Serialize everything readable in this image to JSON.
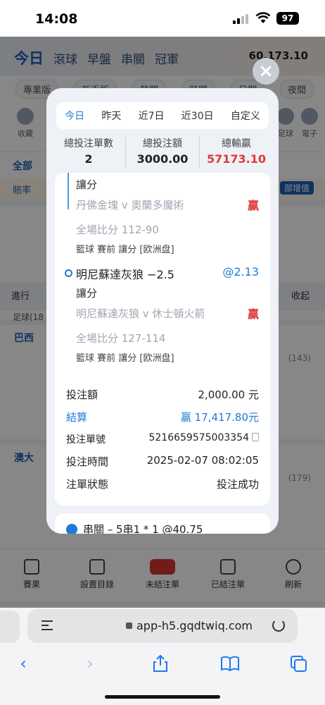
{
  "status_bar": {
    "time": "14:08",
    "battery": "97"
  },
  "background": {
    "nav": {
      "today": "今日",
      "live": "滾球",
      "early": "早盤",
      "parlay": "串關",
      "champion": "冠軍"
    },
    "balance": "60,173.10",
    "filters": {
      "mode": "專業版",
      "newbie": "新手版",
      "hot": "熱門",
      "time": "時間",
      "date": "日期",
      "night": "夜間"
    },
    "cats": {
      "fav": "收藏",
      "football": "足球",
      "esports": "電子"
    },
    "all_tab": "全部",
    "notice": {
      "text": "賠率",
      "tag": "部增值"
    },
    "section": {
      "title": "進行",
      "collapse": "收起",
      "sub": "足球(18"
    },
    "rows": [
      {
        "head": "巴西",
        "count": "(143)"
      },
      {
        "head": "澳大",
        "count": "(179)"
      }
    ],
    "bottom_nav": {
      "results": "賽果",
      "settings": "設置目錄",
      "unsettled": "未結注單",
      "settled": "已結注單",
      "refresh": "刷新"
    }
  },
  "modal": {
    "period_tabs": [
      "今日",
      "昨天",
      "近7日",
      "近30日",
      "自定义"
    ],
    "active_tab": "今日",
    "stats": {
      "count_label": "總投注單數",
      "count": "2",
      "amount_label": "總投注額",
      "amount": "3000.00",
      "winloss_label": "總輸贏",
      "winloss": "57173.10"
    },
    "legs": [
      {
        "bet_type": "讓分",
        "match": "丹佛金塊 v 奧蘭多魔術",
        "result": "贏",
        "score": "全場比分 112-90",
        "meta": "籃球 賽前  讓分 [欧洲盘]"
      },
      {
        "selection": "明尼蘇達灰狼 −2.5",
        "odds": "@2.13",
        "bet_type": "讓分",
        "match": "明尼蘇達灰狼 v 休士頓火箭",
        "result": "贏",
        "score": "全場比分 127-114",
        "meta": "籃球 賽前  讓分 [欧洲盘]"
      }
    ],
    "details": {
      "stake_label": "投注額",
      "stake": "2,000.00 元",
      "settle_label": "結算",
      "settle": "贏 17,417.80元",
      "id_label": "投注單號",
      "id": "5216659575003354",
      "time_label": "投注時間",
      "time": "2025-02-07 08:02:05",
      "status_label": "注單狀態",
      "status": "投注成功"
    },
    "next_card": "串關 – 5串1 * 1 @40.75"
  },
  "browser": {
    "url": "app-h5.gqdtwiq.com"
  },
  "colors": {
    "accent": "#1d7cd6",
    "win": "#e03a3a"
  }
}
